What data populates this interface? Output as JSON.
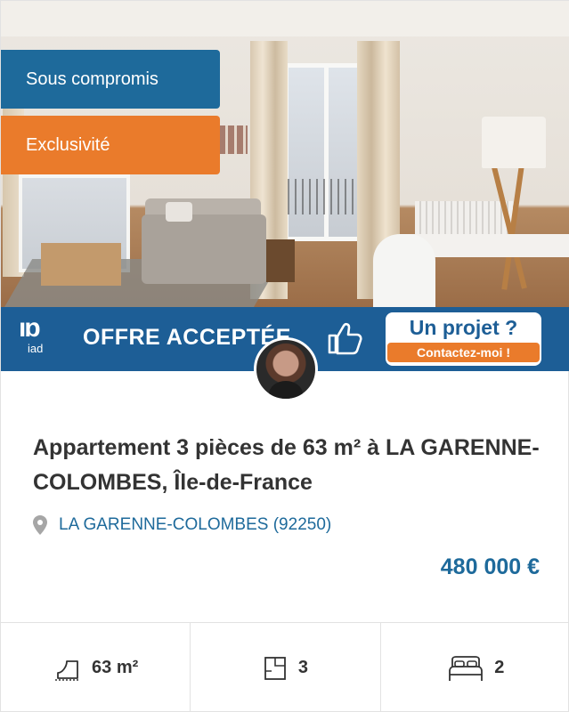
{
  "badges": {
    "status": "Sous compromis",
    "exclusivity": "Exclusivité"
  },
  "banner": {
    "logo_text": "iad",
    "offer_text": "OFFRE ACCEPTÉE",
    "project_title": "Un projet ?",
    "contact_label": "Contactez-moi !"
  },
  "listing": {
    "title": "Appartement 3 pièces de 63 m² à LA GARENNE-COLOMBES, Île-de-France",
    "location": "LA GARENNE-COLOMBES (92250)",
    "price": "480 000 €"
  },
  "features": {
    "surface": "63 m²",
    "rooms": "3",
    "bedrooms": "2"
  },
  "icons": [
    "pin-icon",
    "surface-icon",
    "rooms-icon",
    "bed-icon",
    "thumbs-up-icon"
  ],
  "colors": {
    "primary_blue": "#1e6a9b",
    "orange": "#ea7b2b",
    "banner_blue": "#1d5e96",
    "text": "#333333"
  }
}
